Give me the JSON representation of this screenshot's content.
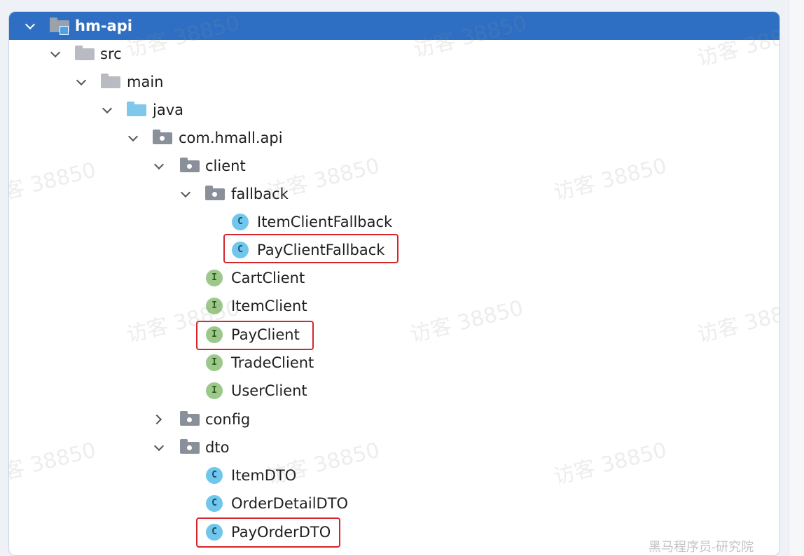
{
  "tree": {
    "root": "hm-api",
    "src": "src",
    "main": "main",
    "java": "java",
    "package": "com.hmall.api",
    "client": "client",
    "fallback": "fallback",
    "item_client_fallback": "ItemClientFallback",
    "pay_client_fallback": "PayClientFallback",
    "cart_client": "CartClient",
    "item_client": "ItemClient",
    "pay_client": "PayClient",
    "trade_client": "TradeClient",
    "user_client": "UserClient",
    "config": "config",
    "dto": "dto",
    "item_dto": "ItemDTO",
    "order_detail_dto": "OrderDetailDTO",
    "pay_order_dto": "PayOrderDTO"
  },
  "badges": {
    "class": "C",
    "interface": "I"
  },
  "icons": {
    "expand": "chevron-down-icon",
    "collapse": "chevron-right-icon",
    "folder": "folder-icon",
    "package": "package-icon",
    "class": "class-icon",
    "interface": "interface-icon"
  },
  "colors": {
    "selection": "#2e6fc4",
    "highlight_box": "#d6262c",
    "class_badge": "#71c6ec",
    "interface_badge": "#9cc98a",
    "source_folder": "#7ec8ea"
  },
  "watermark": "访客 38850",
  "footer": "黑马程序员-研究院"
}
